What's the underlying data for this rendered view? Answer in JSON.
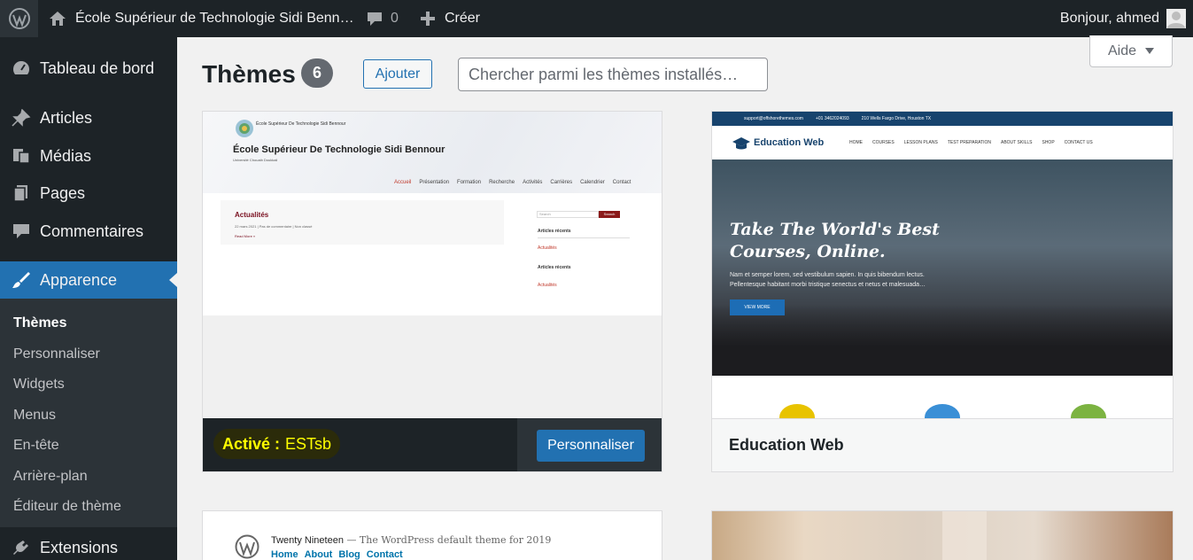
{
  "admin_bar": {
    "site_name": "École Supérieur de Technologie Sidi Benn…",
    "comments_count": "0",
    "create_label": "Créer",
    "greeting": "Bonjour, ahmed"
  },
  "sidebar": {
    "items": [
      {
        "label": "Tableau de bord",
        "icon": "dashboard-icon"
      },
      {
        "label": "Articles",
        "icon": "pin-icon"
      },
      {
        "label": "Médias",
        "icon": "media-icon"
      },
      {
        "label": "Pages",
        "icon": "pages-icon"
      },
      {
        "label": "Commentaires",
        "icon": "comment-icon"
      },
      {
        "label": "Apparence",
        "icon": "brush-icon"
      },
      {
        "label": "Extensions",
        "icon": "plugin-icon"
      }
    ],
    "submenu": [
      "Thèmes",
      "Personnaliser",
      "Widgets",
      "Menus",
      "En-tête",
      "Arrière-plan",
      "Éditeur de thème"
    ]
  },
  "main": {
    "title": "Thèmes",
    "count": "6",
    "add_label": "Ajouter",
    "search_placeholder": "Chercher parmi les thèmes installés…",
    "help_label": "Aide"
  },
  "themes": {
    "active": {
      "active_prefix": "Activé :",
      "name": "ESTsb",
      "customize_label": "Personnaliser",
      "preview": {
        "site_title": "École Supérieur De Technologie Sidi Bennour",
        "site_tagline": "Université Chouaib Doukkali",
        "nav": [
          "Accueil",
          "Présentation",
          "Formation",
          "Recherche",
          "Activités",
          "Carrières",
          "Calendrier",
          "Contact"
        ],
        "heading": "Actualités",
        "meta": "22 mars 2021 | Pas de commentaire | Non classé",
        "read_more": "Read More »",
        "search_placeholder": "Search",
        "search_button": "Search",
        "widget1_title": "Articles récents",
        "widget1_item": "Actualités",
        "widget2_title": "Articles récents",
        "widget2_item": "Actualités"
      }
    },
    "education": {
      "name": "Education Web",
      "preview": {
        "email": "support@offshorethemes.com",
        "phone": "+01 3462024093",
        "address": "210 Wells Fargo Drive, Houston TX",
        "logo_text": "Education Web",
        "nav": [
          "HOME",
          "COURSES",
          "LESSON PLANS",
          "TEST PREPARATION",
          "ABOUT SKILLS",
          "SHOP",
          "CONTACT US"
        ],
        "headline_1": "Take The World's Best",
        "headline_2": "Courses, Online.",
        "body_1": "Nam et semper lorem, sed vestibulum sapien. In quis bibendum lectus.",
        "body_2": "Pellentesque habitant morbi tristique senectus et netus et malesuada…",
        "button": "VIEW MORE"
      }
    },
    "twenty_nineteen": {
      "title": "Twenty Nineteen",
      "tagline": "— The WordPress default theme for 2019",
      "nav": [
        "Home",
        "About",
        "Blog",
        "Contact"
      ]
    }
  },
  "colors": {
    "admin_dark": "#1d2327",
    "accent_blue": "#2271b1",
    "active_highlight": "#ffff00"
  }
}
